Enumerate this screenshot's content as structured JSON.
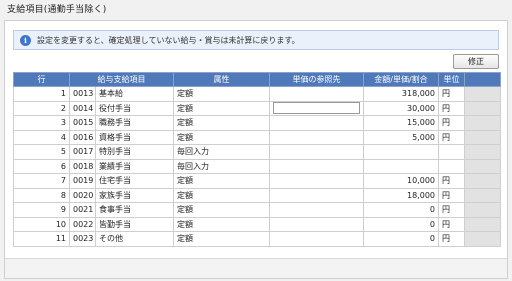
{
  "panel": {
    "title": "支給項目(通勤手当除く)",
    "info": {
      "icon": "info-icon",
      "text": "設定を変更すると、確定処理していない給与・賞与は未計算に戻ります。"
    },
    "edit_label": "修正"
  },
  "table": {
    "headers": [
      "行",
      "給与支給項目",
      "属性",
      "単価の参照先",
      "金額/単価/割合",
      "単位",
      ""
    ],
    "rows": [
      {
        "row": "1",
        "code": "0013",
        "name": "基本給",
        "attr": "定額",
        "ref": "",
        "amount": "318,000",
        "unit": "円"
      },
      {
        "row": "2",
        "code": "0014",
        "name": "役付手当",
        "attr": "定額",
        "ref": "",
        "amount": "30,000",
        "unit": "円"
      },
      {
        "row": "3",
        "code": "0015",
        "name": "職務手当",
        "attr": "定額",
        "ref": "",
        "amount": "15,000",
        "unit": "円"
      },
      {
        "row": "4",
        "code": "0016",
        "name": "資格手当",
        "attr": "定額",
        "ref": "",
        "amount": "5,000",
        "unit": "円"
      },
      {
        "row": "5",
        "code": "0017",
        "name": "特別手当",
        "attr": "毎回入力",
        "ref": "",
        "amount": "",
        "unit": ""
      },
      {
        "row": "6",
        "code": "0018",
        "name": "業績手当",
        "attr": "毎回入力",
        "ref": "",
        "amount": "",
        "unit": ""
      },
      {
        "row": "7",
        "code": "0019",
        "name": "住宅手当",
        "attr": "定額",
        "ref": "",
        "amount": "10,000",
        "unit": "円"
      },
      {
        "row": "8",
        "code": "0020",
        "name": "家族手当",
        "attr": "定額",
        "ref": "",
        "amount": "18,000",
        "unit": "円"
      },
      {
        "row": "9",
        "code": "0021",
        "name": "食事手当",
        "attr": "定額",
        "ref": "",
        "amount": "0",
        "unit": "円"
      },
      {
        "row": "10",
        "code": "0022",
        "name": "皆勤手当",
        "attr": "定額",
        "ref": "",
        "amount": "0",
        "unit": "円"
      },
      {
        "row": "11",
        "code": "0023",
        "name": "その他",
        "attr": "定額",
        "ref": "",
        "amount": "0",
        "unit": "円"
      }
    ]
  },
  "colors": {
    "header_bg": "#5079ba",
    "info_bg": "#eaf1fa",
    "info_icon": "#3f77c8"
  }
}
